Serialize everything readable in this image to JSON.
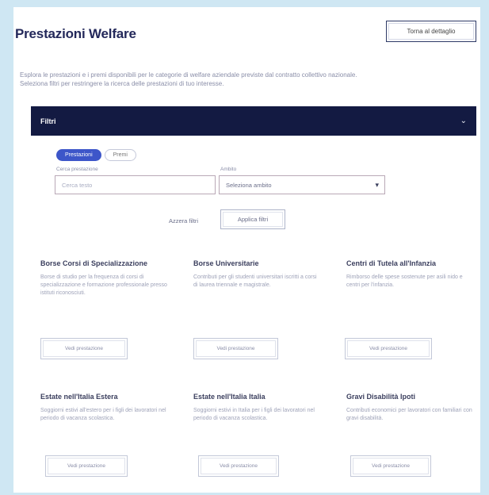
{
  "header": {
    "title": "Prestazioni Welfare",
    "top_button_label": "Torna al dettaglio"
  },
  "intro": {
    "text": "Esplora le prestazioni e i premi disponibili per le categorie di welfare aziendale previste dal contratto collettivo nazionale. Seleziona filtri per restringere la ricerca delle prestazioni di tuo interesse."
  },
  "filters_bar": {
    "label": "Filtri",
    "chevron_icon": "chevron-down-icon"
  },
  "filters": {
    "pills": [
      {
        "label": "Prestazioni",
        "active": true
      },
      {
        "label": "Premi",
        "active": false
      }
    ],
    "search": {
      "label": "Cerca prestazione",
      "placeholder": "Cerca testo"
    },
    "category": {
      "label": "Ambito",
      "value": "Seleziona ambito"
    },
    "reset_label": "Azzera filtri",
    "apply_label": "Applica filtri"
  },
  "cards": [
    {
      "title": "Borse Corsi di Specializzazione",
      "desc": "Borse di studio per la frequenza di corsi di specializzazione e formazione professionale presso istituti riconosciuti.",
      "button": "Vedi prestazione"
    },
    {
      "title": "Borse Universitarie",
      "desc": "Contributi per gli studenti universitari iscritti a corsi di laurea triennale e magistrale.",
      "button": "Vedi prestazione"
    },
    {
      "title": "Centri di Tutela all'Infanzia",
      "desc": "Rimborso delle spese sostenute per asili nido e centri per l'infanzia.",
      "button": "Vedi prestazione"
    },
    {
      "title": "Estate nell'Italia Estera",
      "desc": "Soggiorni estivi all'estero per i figli dei lavoratori nel periodo di vacanza scolastica.",
      "button": "Vedi prestazione"
    },
    {
      "title": "Estate nell'Italia Italia",
      "desc": "Soggiorni estivi in Italia per i figli dei lavoratori nel periodo di vacanza scolastica.",
      "button": "Vedi prestazione"
    },
    {
      "title": "Gravi Disabilità Ipoti",
      "desc": "Contributi economici per lavoratori con familiari con gravi disabilità.",
      "button": "Vedi prestazione"
    }
  ]
}
